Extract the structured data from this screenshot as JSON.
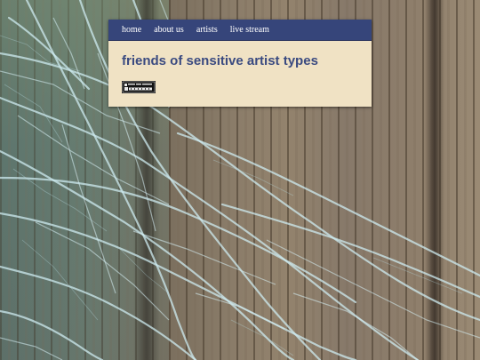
{
  "nav": {
    "items": [
      {
        "label": "home"
      },
      {
        "label": "about us"
      },
      {
        "label": "artists"
      },
      {
        "label": "live stream"
      }
    ]
  },
  "site": {
    "title": "friends of sensitive artist types"
  },
  "badge": {
    "icon": "ascension-badge-icon"
  },
  "colors": {
    "nav_bar": "#36457a",
    "panel": "#f0e2c4",
    "title": "#3a4a80",
    "nav_text": "#ffffff"
  }
}
